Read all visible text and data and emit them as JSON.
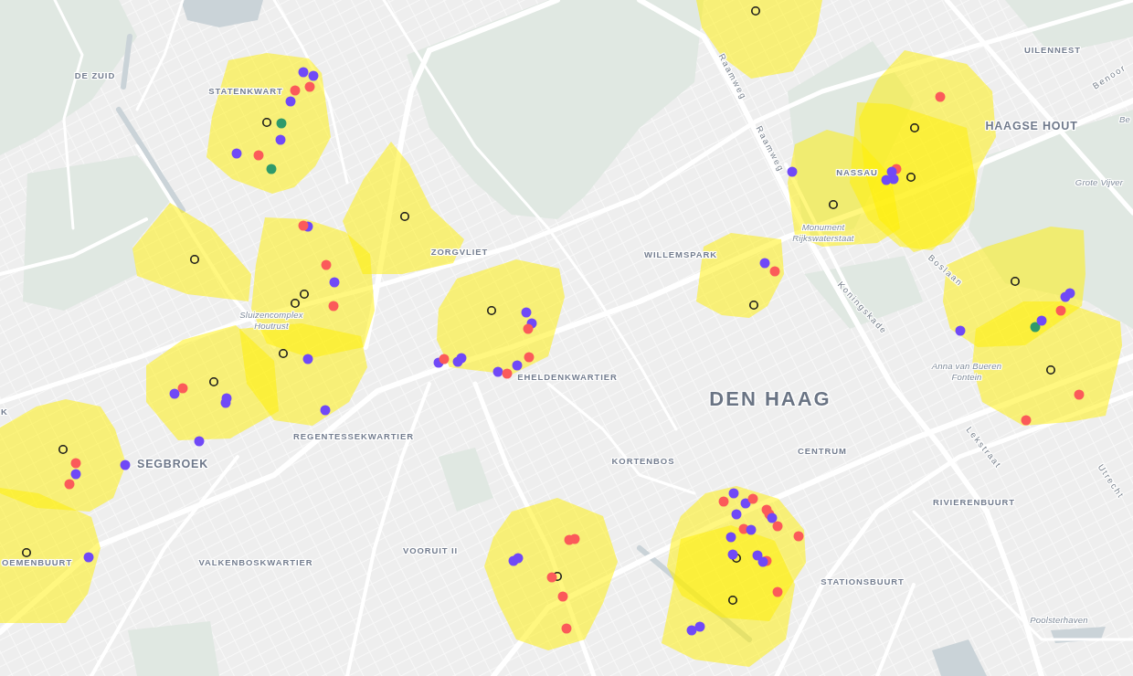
{
  "map": {
    "labels": [
      {
        "text": "Raamweg",
        "kind": "street"
      },
      {
        "text": "UILENNEST",
        "kind": "neighbourhood"
      },
      {
        "text": "DE ZUID",
        "kind": "neighbourhood"
      },
      {
        "text": "STATENKWART",
        "kind": "neighbourhood"
      },
      {
        "text": "Benoor",
        "kind": "street"
      },
      {
        "text": "HAAGSE HOUT",
        "kind": "borough"
      },
      {
        "text": "Be",
        "kind": "landmark"
      },
      {
        "text": "Raamweg",
        "kind": "street"
      },
      {
        "text": "NASSAU",
        "kind": "neighbourhood"
      },
      {
        "text": "Grote Vijver",
        "kind": "landmark"
      },
      {
        "text": "ZORGVLIET",
        "kind": "neighbourhood"
      },
      {
        "text": "WILLEMSPARK",
        "kind": "neighbourhood"
      },
      {
        "text": "Monument Rijkswaterstaat",
        "kind": "landmark"
      },
      {
        "text": "Sluizencomplex Houtrust",
        "kind": "landmark"
      },
      {
        "text": "Boslaan",
        "kind": "street"
      },
      {
        "text": "Koningskade",
        "kind": "street"
      },
      {
        "text": "K",
        "kind": "neighbourhood"
      },
      {
        "text": "EHELDENKWARTIER",
        "kind": "neighbourhood"
      },
      {
        "text": "Anna van Bueren Fontein",
        "kind": "landmark"
      },
      {
        "text": "DEN HAAG",
        "kind": "city"
      },
      {
        "text": "Lekstraat",
        "kind": "street"
      },
      {
        "text": "REGENTESSEKWARTIER",
        "kind": "neighbourhood"
      },
      {
        "text": "CENTRUM",
        "kind": "neighbourhood"
      },
      {
        "text": "KORTENBOS",
        "kind": "neighbourhood"
      },
      {
        "text": "SEGBROEK",
        "kind": "borough"
      },
      {
        "text": "Utrecht",
        "kind": "street"
      },
      {
        "text": "RIVIERENBUURT",
        "kind": "neighbourhood"
      },
      {
        "text": "OEMENBUURT",
        "kind": "neighbourhood"
      },
      {
        "text": "VOORUIT II",
        "kind": "neighbourhood"
      },
      {
        "text": "VALKENBOSKWARTIER",
        "kind": "neighbourhood"
      },
      {
        "text": "STATIONSBUURT",
        "kind": "neighbourhood"
      },
      {
        "text": "Poolsterhaven",
        "kind": "landmark"
      }
    ],
    "areas": [
      {
        "markers": [
          {
            "kind": "center"
          }
        ]
      },
      {
        "markers": [
          {
            "kind": "center"
          },
          {
            "kind": "point",
            "color": "#7049f7"
          },
          {
            "kind": "point",
            "color": "#7049f7"
          },
          {
            "kind": "point",
            "color": "#fb5a5a"
          },
          {
            "kind": "point",
            "color": "#fb5a5a"
          },
          {
            "kind": "point",
            "color": "#7049f7"
          },
          {
            "kind": "point",
            "color": "#2f9a6b"
          },
          {
            "kind": "point",
            "color": "#7049f7"
          },
          {
            "kind": "point",
            "color": "#7049f7"
          },
          {
            "kind": "point",
            "color": "#fb5a5a"
          },
          {
            "kind": "point",
            "color": "#2f9a6b"
          }
        ]
      },
      {
        "markers": [
          {
            "kind": "center"
          }
        ]
      },
      {
        "markers": [
          {
            "kind": "center"
          }
        ]
      },
      {
        "markers": [
          {
            "kind": "center"
          },
          {
            "kind": "center"
          },
          {
            "kind": "point",
            "color": "#7049f7"
          },
          {
            "kind": "point",
            "color": "#fb5a5a"
          },
          {
            "kind": "point",
            "color": "#fb5a5a"
          },
          {
            "kind": "point",
            "color": "#7049f7"
          },
          {
            "kind": "point",
            "color": "#fb5a5a"
          }
        ]
      },
      {
        "markers": [
          {
            "kind": "center"
          },
          {
            "kind": "point",
            "color": "#7049f7"
          },
          {
            "kind": "point",
            "color": "#7049f7"
          }
        ]
      },
      {
        "markers": [
          {
            "kind": "center"
          },
          {
            "kind": "point",
            "color": "#7049f7"
          },
          {
            "kind": "point",
            "color": "#fb5a5a"
          },
          {
            "kind": "point",
            "color": "#7049f7"
          },
          {
            "kind": "point",
            "color": "#7049f7"
          },
          {
            "kind": "point",
            "color": "#7049f7"
          }
        ]
      },
      {
        "markers": [
          {
            "kind": "center"
          },
          {
            "kind": "point",
            "color": "#7049f7"
          },
          {
            "kind": "point",
            "color": "#7049f7"
          },
          {
            "kind": "point",
            "color": "#fb5a5a"
          },
          {
            "kind": "point",
            "color": "#7049f7"
          },
          {
            "kind": "point",
            "color": "#fb5a5a"
          },
          {
            "kind": "point",
            "color": "#7049f7"
          },
          {
            "kind": "point",
            "color": "#7049f7"
          },
          {
            "kind": "point",
            "color": "#7049f7"
          },
          {
            "kind": "point",
            "color": "#fb5a5a"
          },
          {
            "kind": "point",
            "color": "#7049f7"
          },
          {
            "kind": "point",
            "color": "#fb5a5a"
          }
        ]
      },
      {
        "markers": [
          {
            "kind": "center"
          },
          {
            "kind": "point",
            "color": "#fb5a5a"
          },
          {
            "kind": "point",
            "color": "#7049f7"
          },
          {
            "kind": "point",
            "color": "#fb5a5a"
          },
          {
            "kind": "point",
            "color": "#7049f7"
          }
        ]
      },
      {
        "markers": [
          {
            "kind": "center"
          },
          {
            "kind": "point",
            "color": "#7049f7"
          }
        ]
      },
      {
        "markers": [
          {
            "kind": "center"
          },
          {
            "kind": "point",
            "color": "#fb5a5a"
          }
        ]
      },
      {
        "markers": [
          {
            "kind": "center"
          },
          {
            "kind": "point",
            "color": "#fb5a5a"
          },
          {
            "kind": "point",
            "color": "#7049f7"
          },
          {
            "kind": "point",
            "color": "#7049f7"
          },
          {
            "kind": "point",
            "color": "#7049f7"
          }
        ]
      },
      {
        "markers": [
          {
            "kind": "center"
          },
          {
            "kind": "point",
            "color": "#7049f7"
          }
        ]
      },
      {
        "markers": [
          {
            "kind": "center"
          },
          {
            "kind": "point",
            "color": "#7049f7"
          },
          {
            "kind": "point",
            "color": "#fb5a5a"
          }
        ]
      },
      {
        "markers": [
          {
            "kind": "center"
          },
          {
            "kind": "point",
            "color": "#7049f7"
          },
          {
            "kind": "point",
            "color": "#7049f7"
          },
          {
            "kind": "point",
            "color": "#fb5a5a"
          },
          {
            "kind": "point",
            "color": "#7049f7"
          }
        ]
      },
      {
        "markers": [
          {
            "kind": "center"
          },
          {
            "kind": "point",
            "color": "#2f9a6b"
          },
          {
            "kind": "point",
            "color": "#7049f7"
          },
          {
            "kind": "point",
            "color": "#fb5a5a"
          },
          {
            "kind": "point",
            "color": "#fb5a5a"
          }
        ]
      },
      {
        "markers": [
          {
            "kind": "center"
          },
          {
            "kind": "point",
            "color": "#7049f7"
          },
          {
            "kind": "point",
            "color": "#7049f7"
          },
          {
            "kind": "point",
            "color": "#fb5a5a"
          },
          {
            "kind": "point",
            "color": "#fb5a5a"
          },
          {
            "kind": "point",
            "color": "#fb5a5a"
          },
          {
            "kind": "point",
            "color": "#fb5a5a"
          },
          {
            "kind": "point",
            "color": "#fb5a5a"
          }
        ]
      },
      {
        "markers": [
          {
            "kind": "center"
          },
          {
            "kind": "point",
            "color": "#7049f7"
          },
          {
            "kind": "point",
            "color": "#fb5a5a"
          },
          {
            "kind": "point",
            "color": "#7049f7"
          },
          {
            "kind": "point",
            "color": "#fb5a5a"
          },
          {
            "kind": "point",
            "color": "#fb5a5a"
          },
          {
            "kind": "point",
            "color": "#fb5a5a"
          },
          {
            "kind": "point",
            "color": "#7049f7"
          },
          {
            "kind": "point",
            "color": "#7049f7"
          },
          {
            "kind": "point",
            "color": "#fb5a5a"
          },
          {
            "kind": "point",
            "color": "#fb5a5a"
          },
          {
            "kind": "point",
            "color": "#7049f7"
          },
          {
            "kind": "point",
            "color": "#7049f7"
          },
          {
            "kind": "point",
            "color": "#fb5a5a"
          },
          {
            "kind": "point",
            "color": "#7049f7"
          },
          {
            "kind": "point",
            "color": "#fb5a5a"
          },
          {
            "kind": "point",
            "color": "#7049f7"
          },
          {
            "kind": "point",
            "color": "#7049f7"
          },
          {
            "kind": "point",
            "color": "#fb5a5a"
          }
        ]
      },
      {
        "markers": [
          {
            "kind": "center"
          },
          {
            "kind": "point",
            "color": "#7049f7"
          },
          {
            "kind": "point",
            "color": "#7049f7"
          }
        ]
      }
    ]
  }
}
